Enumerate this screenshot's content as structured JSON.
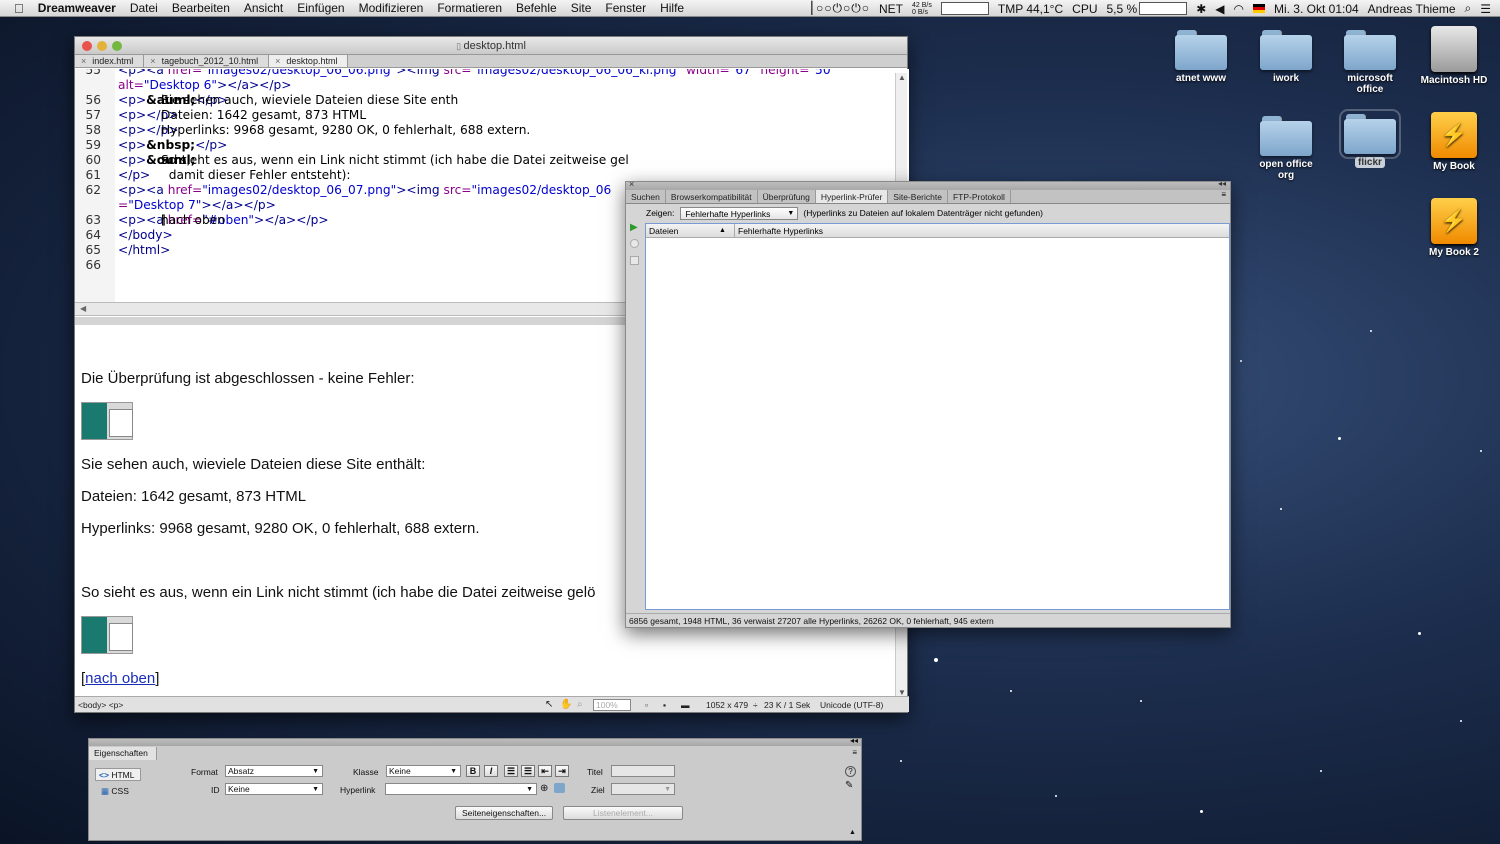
{
  "menubar": {
    "app": "Dreamweaver",
    "items": [
      "Datei",
      "Bearbeiten",
      "Ansicht",
      "Einfügen",
      "Modifizieren",
      "Formatieren",
      "Befehle",
      "Site",
      "Fenster",
      "Hilfe"
    ],
    "net": "NET",
    "net_in": "42 B/s",
    "net_out": "0 B/s",
    "tmp": "TMP 44,1°C",
    "cpu": "CPU",
    "cpu_val": "5,5 %",
    "datetime": "Mi. 3. Okt 01:04",
    "user": "Andreas Thieme"
  },
  "desktop": {
    "icons": [
      {
        "label": "atnet www"
      },
      {
        "label": "iwork"
      },
      {
        "label": "microsoft office"
      },
      {
        "label": "Macintosh HD"
      },
      {
        "label": "open office org"
      },
      {
        "label": "flickr"
      },
      {
        "label": "My Book"
      },
      {
        "label": "My Book 2"
      }
    ]
  },
  "editor": {
    "title": "desktop.html",
    "tabs": [
      "index.html",
      "tagebuch_2012_10.html",
      "desktop.html"
    ],
    "code_lines": [
      {
        "n": "55",
        "parts": [
          [
            "tg",
            "<p><a "
          ],
          [
            "at",
            "href="
          ],
          [
            "vl",
            "\"images02/desktop_06_06.png\""
          ],
          [
            "tg",
            "><img "
          ],
          [
            "at",
            "src="
          ],
          [
            "vl",
            "\"images02/desktop_06_06_kl.png\""
          ],
          [
            "at",
            " width="
          ],
          [
            "vl",
            "\"67\""
          ],
          [
            "at",
            " height="
          ],
          [
            "vl",
            "\"50\""
          ]
        ]
      },
      {
        "n": "",
        "parts": [
          [
            "at",
            "alt="
          ],
          [
            "vl",
            "\"Desktop 6\""
          ],
          [
            "tg",
            "></a></p>"
          ]
        ]
      },
      {
        "n": "56",
        "parts": [
          [
            "tg",
            "<p>"
          ],
          [
            "",
            ""
          ],
          [
            "t",
            "Sie sehen auch, wieviele Dateien diese Site enth"
          ],
          [
            "en",
            "&auml;"
          ],
          [
            "t",
            "lt:"
          ],
          [
            "tg",
            "</p>"
          ]
        ]
      },
      {
        "n": "57",
        "parts": [
          [
            "tg",
            "<p>"
          ],
          [
            "t",
            "Dateien: 1642 gesamt, 873 HTML"
          ],
          [
            "tg",
            "</p>"
          ]
        ]
      },
      {
        "n": "58",
        "parts": [
          [
            "tg",
            "<p>"
          ],
          [
            "t",
            "Hyperlinks: 9968 gesamt, 9280 OK, 0 fehlerhalt, 688 extern."
          ],
          [
            "tg",
            "</p>"
          ]
        ]
      },
      {
        "n": "59",
        "parts": [
          [
            "tg",
            "<p>"
          ],
          [
            "en",
            "&nbsp;"
          ],
          [
            "tg",
            "</p>"
          ]
        ]
      },
      {
        "n": "60",
        "parts": [
          [
            "tg",
            "<p>"
          ],
          [
            "t",
            "So sieht es aus, wenn ein Link nicht stimmt (ich habe die Datei zeitweise gel"
          ],
          [
            "en",
            "&ouml;"
          ],
          [
            "t",
            "scht,"
          ]
        ]
      },
      {
        "n": "61",
        "parts": [
          [
            "t",
            "  damit dieser Fehler entsteht):"
          ],
          [
            "tg",
            "</p>"
          ]
        ]
      },
      {
        "n": "62",
        "parts": [
          [
            "tg",
            "<p><a "
          ],
          [
            "at",
            "href="
          ],
          [
            "vl",
            "\"images02/desktop_06_07.png\""
          ],
          [
            "tg",
            "><img "
          ],
          [
            "at",
            "src="
          ],
          [
            "vl",
            "\"images02/desktop_06"
          ]
        ]
      },
      {
        "n": "",
        "parts": [
          [
            "at",
            "="
          ],
          [
            "vl",
            "\"Desktop 7\""
          ],
          [
            "t",
            "   "
          ],
          [
            "tg",
            "></a></p>"
          ]
        ]
      },
      {
        "n": "63",
        "parts": [
          [
            "tg",
            "<p>"
          ],
          [
            "t",
            "["
          ],
          [
            "tg",
            "<a "
          ],
          [
            "at",
            "href="
          ],
          [
            "vl",
            "\"#oben\""
          ],
          [
            "tg",
            ">"
          ],
          [
            "t",
            "nach oben"
          ],
          [
            "tg",
            "</a>"
          ],
          [
            "t",
            "]"
          ],
          [
            "tg",
            "</p>"
          ]
        ]
      },
      {
        "n": "64",
        "parts": [
          [
            "tg",
            "</body>"
          ]
        ]
      },
      {
        "n": "65",
        "parts": [
          [
            "tg",
            "</html>"
          ]
        ]
      },
      {
        "n": "66",
        "parts": []
      }
    ],
    "design": {
      "p1": "Die Überprüfung ist abgeschlossen - keine Fehler:",
      "p2": "Sie sehen auch, wieviele Dateien diese Site enthält:",
      "p3": "Dateien: 1642 gesamt, 873 HTML",
      "p4": "Hyperlinks: 9968 gesamt, 9280 OK, 0 fehlerhalt, 688 extern.",
      "p5": "So sieht es aus, wenn ein Link nicht stimmt (ich habe die Datei zeitweise gelö",
      "link_pre": "[",
      "link": "nach oben",
      "link_post": "]"
    },
    "status": {
      "tags": "<body> <p>",
      "zoom": "100%",
      "size": "1052 x 479",
      "size_arrow": "÷",
      "speed": "23 K / 1 Sek",
      "encoding": "Unicode (UTF-8)"
    }
  },
  "panel": {
    "tabs": [
      "Suchen",
      "Browserkompatibilität",
      "Überprüfung",
      "Hyperlink-Prüfer",
      "Site-Berichte",
      "FTP-Protokoll"
    ],
    "active_tab": 3,
    "show_label": "Zeigen:",
    "show_value": "Fehlerhafte Hyperlinks",
    "show_note": "(Hyperlinks zu Dateien auf lokalem Datenträger nicht gefunden)",
    "col1": "Dateien",
    "col2": "Fehlerhafte Hyperlinks",
    "status": "6856 gesamt,  1948 HTML,  36 verwaist  27207 alle Hyperlinks, 26262 OK, 0 fehlerhaft, 945 extern"
  },
  "props": {
    "title": "Eigenschaften",
    "html": "HTML",
    "css": "CSS",
    "format_label": "Format",
    "format_value": "Absatz",
    "class_label": "Klasse",
    "class_value": "Keine",
    "title_label": "Titel",
    "id_label": "ID",
    "id_value": "Keine",
    "link_label": "Hyperlink",
    "target_label": "Ziel",
    "page_props": "Seiteneigenschaften...",
    "list_item": "Listenelement...",
    "bold": "B",
    "italic": "I"
  }
}
